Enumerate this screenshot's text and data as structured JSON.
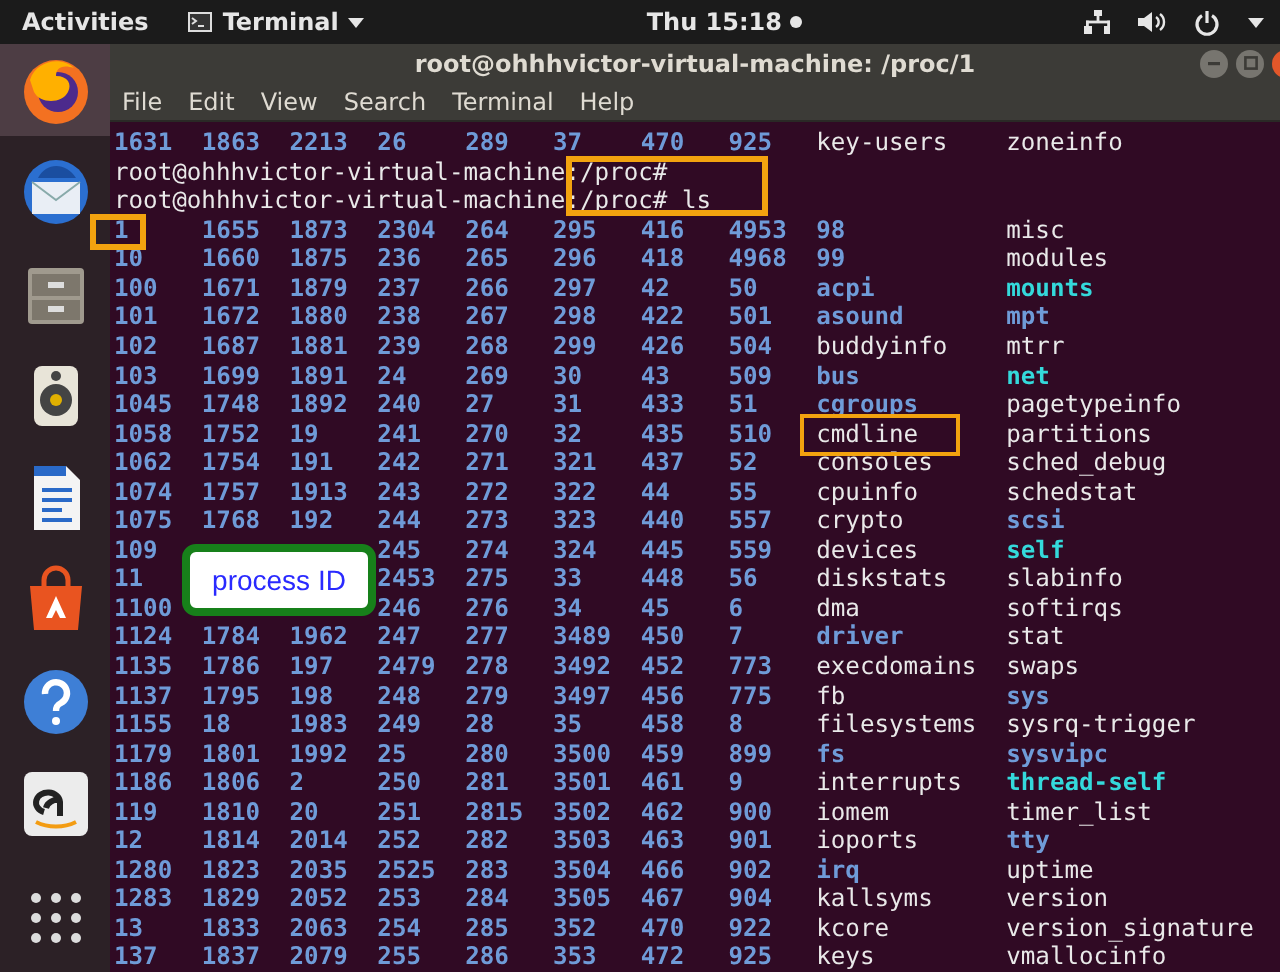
{
  "top_bar": {
    "activities": "Activities",
    "app_menu": "Terminal",
    "clock": "Thu 15:18"
  },
  "dock": {
    "items": [
      {
        "kind": "browser",
        "selected": true
      },
      {
        "kind": "mail",
        "selected": false
      },
      {
        "kind": "files",
        "selected": false
      },
      {
        "kind": "speaker",
        "selected": false
      },
      {
        "kind": "document",
        "selected": false
      },
      {
        "kind": "store",
        "selected": false
      },
      {
        "kind": "help",
        "selected": false
      },
      {
        "kind": "amazon",
        "selected": false
      },
      {
        "kind": "apps",
        "selected": false
      }
    ]
  },
  "window": {
    "title": "root@ohhhvictor-virtual-machine: /proc/1",
    "menu": [
      "File",
      "Edit",
      "View",
      "Search",
      "Terminal",
      "Help"
    ]
  },
  "terminal": {
    "lines": [
      {
        "kind": "listing",
        "pids": [
          "1631",
          "1863",
          "2213",
          "26",
          "289",
          "37",
          "470",
          "925"
        ],
        "entries": [
          {
            "text": "key-users",
            "kind": "file"
          },
          {
            "text": "zoneinfo",
            "kind": "file"
          }
        ]
      },
      {
        "kind": "prompt",
        "prompt": "root@ohhhvictor-virtual-machine:/proc#"
      },
      {
        "kind": "prompt",
        "prompt": "root@ohhhvictor-virtual-machine:/proc#",
        "command": "ls"
      },
      {
        "kind": "listing",
        "pids": [
          "1",
          "1655",
          "1873",
          "2304",
          "264",
          "295",
          "416",
          "4953"
        ],
        "entries": [
          {
            "text": "98",
            "kind": "dir"
          },
          {
            "text": "misc",
            "kind": "file"
          }
        ]
      },
      {
        "kind": "listing",
        "pids": [
          "10",
          "1660",
          "1875",
          "236",
          "265",
          "296",
          "418",
          "4968"
        ],
        "entries": [
          {
            "text": "99",
            "kind": "dir"
          },
          {
            "text": "modules",
            "kind": "file"
          }
        ]
      },
      {
        "kind": "listing",
        "pids": [
          "100",
          "1671",
          "1879",
          "237",
          "266",
          "297",
          "42",
          "50"
        ],
        "entries": [
          {
            "text": "acpi",
            "kind": "dir"
          },
          {
            "text": "mounts",
            "kind": "link"
          }
        ]
      },
      {
        "kind": "listing",
        "pids": [
          "101",
          "1672",
          "1880",
          "238",
          "267",
          "298",
          "422",
          "501"
        ],
        "entries": [
          {
            "text": "asound",
            "kind": "dir"
          },
          {
            "text": "mpt",
            "kind": "dir"
          }
        ]
      },
      {
        "kind": "listing",
        "pids": [
          "102",
          "1687",
          "1881",
          "239",
          "268",
          "299",
          "426",
          "504"
        ],
        "entries": [
          {
            "text": "buddyinfo",
            "kind": "file"
          },
          {
            "text": "mtrr",
            "kind": "file"
          }
        ]
      },
      {
        "kind": "listing",
        "pids": [
          "103",
          "1699",
          "1891",
          "24",
          "269",
          "30",
          "43",
          "509"
        ],
        "entries": [
          {
            "text": "bus",
            "kind": "dir"
          },
          {
            "text": "net",
            "kind": "link"
          }
        ]
      },
      {
        "kind": "listing",
        "pids": [
          "1045",
          "1748",
          "1892",
          "240",
          "27",
          "31",
          "433",
          "51"
        ],
        "entries": [
          {
            "text": "cgroups",
            "kind": "dir"
          },
          {
            "text": "pagetypeinfo",
            "kind": "file"
          }
        ]
      },
      {
        "kind": "listing",
        "pids": [
          "1058",
          "1752",
          "19",
          "241",
          "270",
          "32",
          "435",
          "510"
        ],
        "entries": [
          {
            "text": "cmdline",
            "kind": "file"
          },
          {
            "text": "partitions",
            "kind": "file"
          }
        ]
      },
      {
        "kind": "listing",
        "pids": [
          "1062",
          "1754",
          "191",
          "242",
          "271",
          "321",
          "437",
          "52"
        ],
        "entries": [
          {
            "text": "consoles",
            "kind": "file"
          },
          {
            "text": "sched_debug",
            "kind": "file"
          }
        ]
      },
      {
        "kind": "listing",
        "pids": [
          "1074",
          "1757",
          "1913",
          "243",
          "272",
          "322",
          "44",
          "55"
        ],
        "entries": [
          {
            "text": "cpuinfo",
            "kind": "file"
          },
          {
            "text": "schedstat",
            "kind": "file"
          }
        ]
      },
      {
        "kind": "listing",
        "pids": [
          "1075",
          "1768",
          "192",
          "244",
          "273",
          "323",
          "440",
          "557"
        ],
        "entries": [
          {
            "text": "crypto",
            "kind": "file"
          },
          {
            "text": "scsi",
            "kind": "dir"
          }
        ]
      },
      {
        "kind": "covered_listing",
        "lead": [
          "109"
        ],
        "pids": [
          "245",
          "274",
          "324",
          "445",
          "559"
        ],
        "entries": [
          {
            "text": "devices",
            "kind": "file"
          },
          {
            "text": "self",
            "kind": "link"
          }
        ]
      },
      {
        "kind": "covered_listing",
        "lead": [
          "11"
        ],
        "pids": [
          "2453",
          "275",
          "33",
          "448",
          "56"
        ],
        "entries": [
          {
            "text": "diskstats",
            "kind": "file"
          },
          {
            "text": "slabinfo",
            "kind": "file"
          }
        ]
      },
      {
        "kind": "covered_listing",
        "lead": [
          "1100"
        ],
        "pids": [
          "246",
          "276",
          "34",
          "45",
          "6"
        ],
        "entries": [
          {
            "text": "dma",
            "kind": "file"
          },
          {
            "text": "softirqs",
            "kind": "file"
          }
        ]
      },
      {
        "kind": "listing",
        "pids": [
          "1124",
          "1784",
          "1962",
          "247",
          "277",
          "3489",
          "450",
          "7"
        ],
        "entries": [
          {
            "text": "driver",
            "kind": "dir"
          },
          {
            "text": "stat",
            "kind": "file"
          }
        ]
      },
      {
        "kind": "listing",
        "pids": [
          "1135",
          "1786",
          "197",
          "2479",
          "278",
          "3492",
          "452",
          "773"
        ],
        "entries": [
          {
            "text": "execdomains",
            "kind": "file"
          },
          {
            "text": "swaps",
            "kind": "file"
          }
        ]
      },
      {
        "kind": "listing",
        "pids": [
          "1137",
          "1795",
          "198",
          "248",
          "279",
          "3497",
          "456",
          "775"
        ],
        "entries": [
          {
            "text": "fb",
            "kind": "file"
          },
          {
            "text": "sys",
            "kind": "dir"
          }
        ]
      },
      {
        "kind": "listing",
        "pids": [
          "1155",
          "18",
          "1983",
          "249",
          "28",
          "35",
          "458",
          "8"
        ],
        "entries": [
          {
            "text": "filesystems",
            "kind": "file"
          },
          {
            "text": "sysrq-trigger",
            "kind": "file"
          }
        ]
      },
      {
        "kind": "listing",
        "pids": [
          "1179",
          "1801",
          "1992",
          "25",
          "280",
          "3500",
          "459",
          "899"
        ],
        "entries": [
          {
            "text": "fs",
            "kind": "dir"
          },
          {
            "text": "sysvipc",
            "kind": "dir"
          }
        ]
      },
      {
        "kind": "listing",
        "pids": [
          "1186",
          "1806",
          "2",
          "250",
          "281",
          "3501",
          "461",
          "9"
        ],
        "entries": [
          {
            "text": "interrupts",
            "kind": "file"
          },
          {
            "text": "thread-self",
            "kind": "link"
          }
        ]
      },
      {
        "kind": "listing",
        "pids": [
          "119",
          "1810",
          "20",
          "251",
          "2815",
          "3502",
          "462",
          "900"
        ],
        "entries": [
          {
            "text": "iomem",
            "kind": "file"
          },
          {
            "text": "timer_list",
            "kind": "file"
          }
        ]
      },
      {
        "kind": "listing",
        "pids": [
          "12",
          "1814",
          "2014",
          "252",
          "282",
          "3503",
          "463",
          "901"
        ],
        "entries": [
          {
            "text": "ioports",
            "kind": "file"
          },
          {
            "text": "tty",
            "kind": "dir"
          }
        ]
      },
      {
        "kind": "listing",
        "pids": [
          "1280",
          "1823",
          "2035",
          "2525",
          "283",
          "3504",
          "466",
          "902"
        ],
        "entries": [
          {
            "text": "irq",
            "kind": "dir"
          },
          {
            "text": "uptime",
            "kind": "file"
          }
        ]
      },
      {
        "kind": "listing",
        "pids": [
          "1283",
          "1829",
          "2052",
          "253",
          "284",
          "3505",
          "467",
          "904"
        ],
        "entries": [
          {
            "text": "kallsyms",
            "kind": "file"
          },
          {
            "text": "version",
            "kind": "file"
          }
        ]
      },
      {
        "kind": "listing",
        "pids": [
          "13",
          "1833",
          "2063",
          "254",
          "285",
          "352",
          "470",
          "922"
        ],
        "entries": [
          {
            "text": "kcore",
            "kind": "file"
          },
          {
            "text": "version_signature",
            "kind": "file"
          }
        ]
      },
      {
        "kind": "listing",
        "pids": [
          "137",
          "1837",
          "2079",
          "255",
          "286",
          "353",
          "472",
          "925"
        ],
        "entries": [
          {
            "text": "keys",
            "kind": "file"
          },
          {
            "text": "vmallocinfo",
            "kind": "file"
          }
        ]
      }
    ]
  },
  "callout": {
    "text": "process ID"
  }
}
